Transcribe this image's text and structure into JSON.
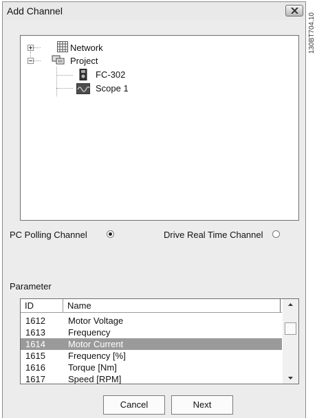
{
  "window": {
    "title": "Add Channel"
  },
  "tree": {
    "items": [
      {
        "label": "Network",
        "icon": "network-grid-icon"
      },
      {
        "label": "Project",
        "icon": "project-icon"
      },
      {
        "label": "FC-302",
        "icon": "drive-icon"
      },
      {
        "label": "Scope 1",
        "icon": "scope-icon"
      }
    ]
  },
  "channel": {
    "pc_polling_label": "PC Polling Channel",
    "drive_realtime_label": "Drive Real Time Channel",
    "selected": "pc_polling"
  },
  "parameter": {
    "label": "Parameter",
    "columns": [
      "ID",
      "Name"
    ],
    "rows": [
      {
        "id": "1612",
        "name": "Motor Voltage"
      },
      {
        "id": "1613",
        "name": "Frequency"
      },
      {
        "id": "1614",
        "name": "Motor Current"
      },
      {
        "id": "1615",
        "name": "Frequency [%]"
      },
      {
        "id": "1616",
        "name": "Torque [Nm]"
      },
      {
        "id": "1617",
        "name": "Speed [RPM]"
      }
    ],
    "selected_index": 2
  },
  "buttons": {
    "cancel": "Cancel",
    "next": "Next"
  },
  "side_code": "130BT704.10"
}
